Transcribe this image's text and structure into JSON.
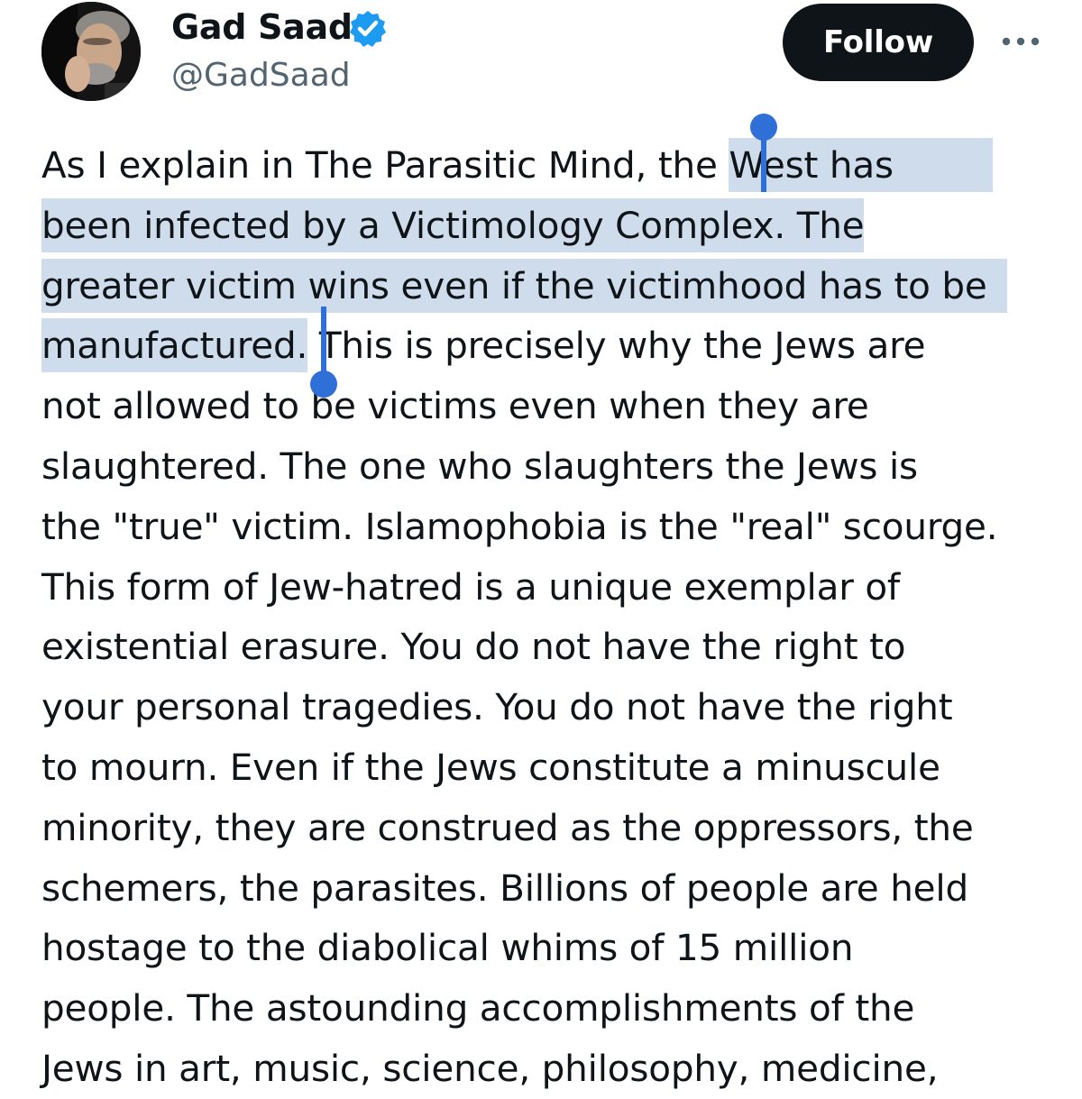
{
  "author": {
    "display_name": "Gad Saad",
    "handle": "@GadSaad",
    "verified_icon": "verified-badge-icon",
    "avatar_icon": "avatar-photo"
  },
  "actions": {
    "follow_label": "Follow",
    "more_icon": "more-icon"
  },
  "tweet": {
    "lines": [
      {
        "before": "As I explain in The Parasitic Mind, the ",
        "selected": "West has",
        "after": ""
      },
      {
        "before": "",
        "selected": "been infected by a Victimology Complex.  The",
        "after": ""
      },
      {
        "before": "",
        "selected": "greater victim wins even if the victimhood has to be",
        "after": ""
      },
      {
        "before": "",
        "selected": "manufactured.",
        "after": " This is precisely why the Jews are"
      },
      {
        "text": "not allowed to be victims even when they are"
      },
      {
        "text": "slaughtered.  The one who slaughters the Jews is"
      },
      {
        "text": "the \"true\" victim.  Islamophobia is the \"real\" scourge."
      },
      {
        "text": "This form of Jew-hatred is a unique exemplar of"
      },
      {
        "text": "existential erasure.  You do not have the right to"
      },
      {
        "text": "your personal tragedies.  You do not have the right"
      },
      {
        "text": "to mourn.  Even if the Jews constitute a minuscule"
      },
      {
        "text": "minority, they are construed as the oppressors, the"
      },
      {
        "text": "schemers, the parasites.  Billions of people are held"
      },
      {
        "text": "hostage to the diabolical whims of 15 million"
      },
      {
        "text": "people.  The astounding accomplishments of the"
      },
      {
        "text": "Jews in art, music, science, philosophy, medicine,"
      }
    ]
  },
  "colors": {
    "selection_highlight": "#cfdcec",
    "selection_handle": "#2f6fd8",
    "verified_blue": "#1d9bf0",
    "follow_button_bg": "#0f1419",
    "handle_text": "#536471"
  }
}
